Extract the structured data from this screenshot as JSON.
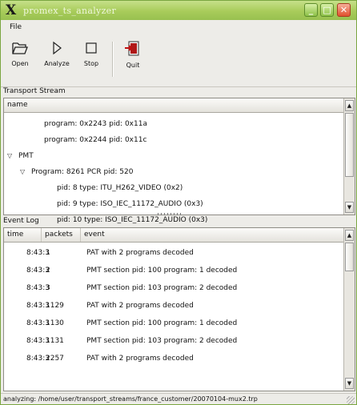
{
  "window": {
    "title": "promex_ts_analyzer",
    "buttons": {
      "minimize": "_",
      "maximize": "□",
      "close": "✕"
    }
  },
  "menu": {
    "file": "File"
  },
  "toolbar": {
    "open": {
      "label": "Open",
      "icon": "folder-open-icon"
    },
    "analyze": {
      "label": "Analyze",
      "icon": "play-icon"
    },
    "stop": {
      "label": "Stop",
      "icon": "stop-icon"
    },
    "quit": {
      "label": "Quit",
      "icon": "exit-door-icon"
    }
  },
  "transport_stream": {
    "frame_label": "Transport Stream",
    "column": "name",
    "rows": [
      {
        "indent": 2,
        "expander": "",
        "text": "program: 0x2243 pid: 0x11a"
      },
      {
        "indent": 2,
        "expander": "",
        "text": "program: 0x2244 pid: 0x11c"
      },
      {
        "indent": 0,
        "expander": "▽",
        "text": "PMT"
      },
      {
        "indent": 1,
        "expander": "▽",
        "text": "Program: 8261 PCR pid: 520"
      },
      {
        "indent": 3,
        "expander": "",
        "text": "pid: 8 type: ITU_H262_VIDEO (0x2)"
      },
      {
        "indent": 3,
        "expander": "",
        "text": "pid: 9 type: ISO_IEC_11172_AUDIO (0x3)"
      },
      {
        "indent": 3,
        "expander": "",
        "text": "pid: 10 type: ISO_IEC_11172_AUDIO (0x3)"
      }
    ]
  },
  "event_log": {
    "frame_label": "Event Log",
    "columns": {
      "time": "time",
      "packets": "packets",
      "event": "event"
    },
    "rows": [
      {
        "time": "8:43:3",
        "packets": "1",
        "event": "PAT with 2 programs decoded"
      },
      {
        "time": "8:43:3",
        "packets": "2",
        "event": "PMT section pid: 100 program: 1 decoded"
      },
      {
        "time": "8:43:3",
        "packets": "3",
        "event": "PMT section pid: 103 program: 2 decoded"
      },
      {
        "time": "8:43:3",
        "packets": "1129",
        "event": "PAT with 2 programs decoded"
      },
      {
        "time": "8:43:3",
        "packets": "1130",
        "event": "PMT section pid: 100 program: 1 decoded"
      },
      {
        "time": "8:43:3",
        "packets": "1131",
        "event": "PMT section pid: 103 program: 2 decoded"
      },
      {
        "time": "8:43:3",
        "packets": "2257",
        "event": "PAT with 2 programs decoded"
      }
    ]
  },
  "status": {
    "text": "analyzing: /home/user/transport_streams/france_customer/20070104-mux2.trp"
  },
  "colors": {
    "titlebar": "#a8cc5a",
    "close_button": "#e0502e",
    "window_bg": "#edece8"
  }
}
